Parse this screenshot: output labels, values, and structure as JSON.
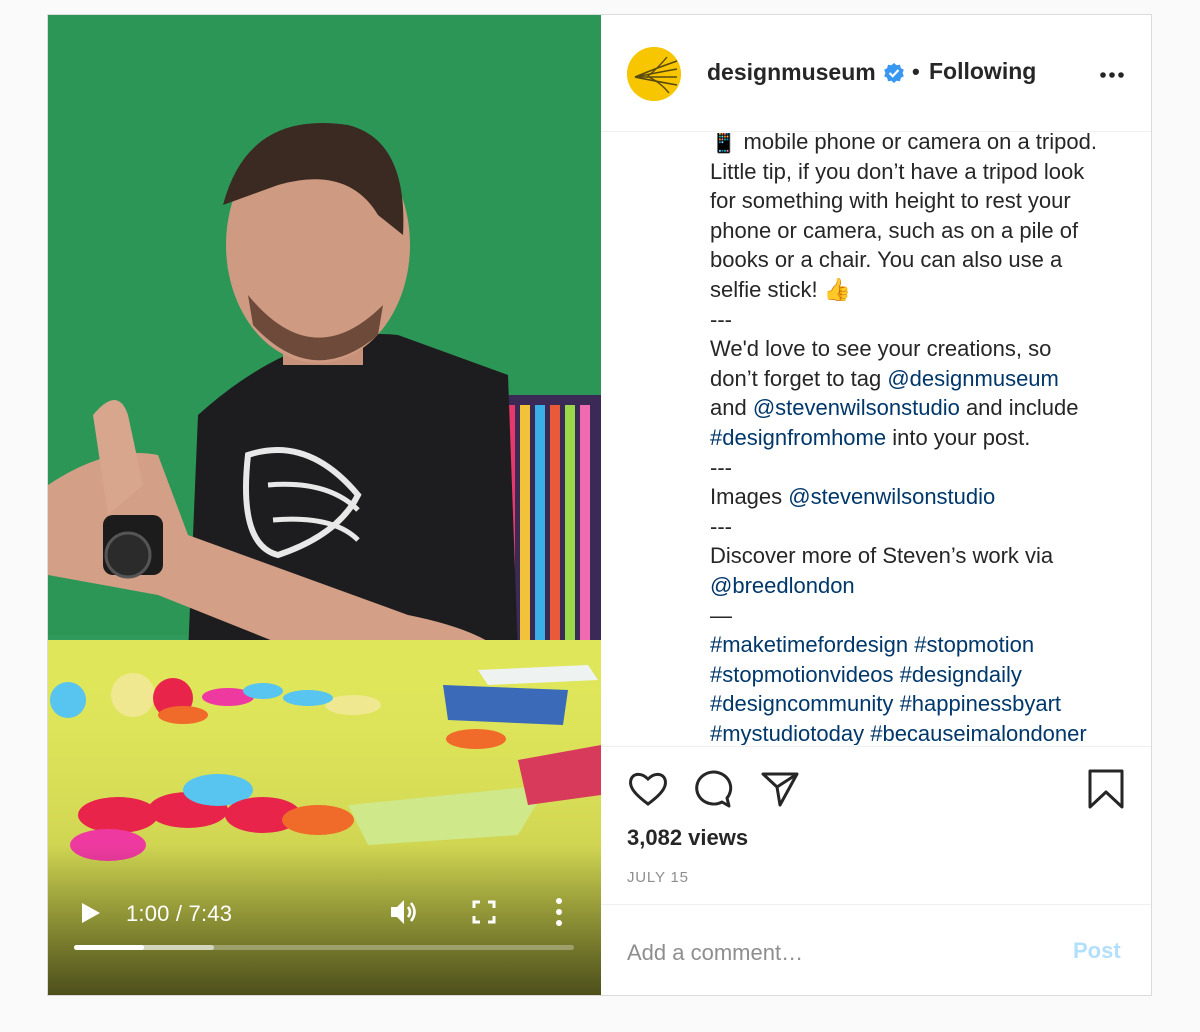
{
  "video": {
    "time_display": "1:00 / 7:43",
    "progress": {
      "played": 0.14,
      "buffered": 0.28
    },
    "icons": {
      "play": "play-icon",
      "volume": "volume-icon",
      "fullscreen": "fullscreen-icon",
      "more": "more-vertical-icon"
    }
  },
  "header": {
    "username": "designmuseum",
    "verified_icon": "verified-badge-icon",
    "separator": "•",
    "follow_status": "Following",
    "options_icon": "more-horizontal-icon",
    "avatar_color": "#f7c600"
  },
  "caption": {
    "lines": [
      [
        {
          "t": "📱 mobile phone or camera on a tripod."
        }
      ],
      [
        {
          "t": "Little tip, if you don’t have a tripod look"
        }
      ],
      [
        {
          "t": "for something with height to rest your"
        }
      ],
      [
        {
          "t": "phone or camera, such as on a pile of"
        }
      ],
      [
        {
          "t": "books or a chair. You can also use a"
        }
      ],
      [
        {
          "t": "selfie stick! 👍"
        }
      ],
      [
        {
          "t": "---"
        }
      ],
      [
        {
          "t": "We'd love to see your creations, so"
        }
      ],
      [
        {
          "t": "don’t forget to tag "
        },
        {
          "t": "@designmuseum",
          "link": true
        }
      ],
      [
        {
          "t": "and "
        },
        {
          "t": "@stevenwilsonstudio",
          "link": true
        },
        {
          "t": " and include"
        }
      ],
      [
        {
          "t": "#designfromhome",
          "link": true
        },
        {
          "t": " into your post."
        }
      ],
      [
        {
          "t": "---"
        }
      ],
      [
        {
          "t": "Images "
        },
        {
          "t": "@stevenwilsonstudio",
          "link": true
        }
      ],
      [
        {
          "t": "---"
        }
      ],
      [
        {
          "t": "Discover more of Steven’s work via"
        }
      ],
      [
        {
          "t": "@breedlondon",
          "link": true
        }
      ],
      [
        {
          "t": "—"
        }
      ],
      [
        {
          "t": "#maketimefordesign",
          "link": true
        },
        {
          "t": " "
        },
        {
          "t": "#stopmotion",
          "link": true
        }
      ],
      [
        {
          "t": "#stopmotionvideos",
          "link": true
        },
        {
          "t": " "
        },
        {
          "t": "#designdaily",
          "link": true
        }
      ],
      [
        {
          "t": "#designcommunity",
          "link": true
        },
        {
          "t": " "
        },
        {
          "t": "#happinessbyart",
          "link": true
        }
      ],
      [
        {
          "t": "#mystudiotoday",
          "link": true
        },
        {
          "t": " "
        },
        {
          "t": "#becauseimalondoner",
          "link": true
        }
      ]
    ]
  },
  "actions": {
    "icons": {
      "like": "heart-icon",
      "comment": "comment-bubble-icon",
      "share": "send-arrow-icon",
      "save": "bookmark-icon"
    },
    "views": "3,082 views",
    "date": "JULY 15"
  },
  "comment": {
    "placeholder": "Add a comment…",
    "post_label": "Post"
  },
  "colors": {
    "link": "#00376b",
    "post_disabled": "#b2dffc",
    "muted": "#8e8e8e",
    "verified": "#3897f0"
  }
}
